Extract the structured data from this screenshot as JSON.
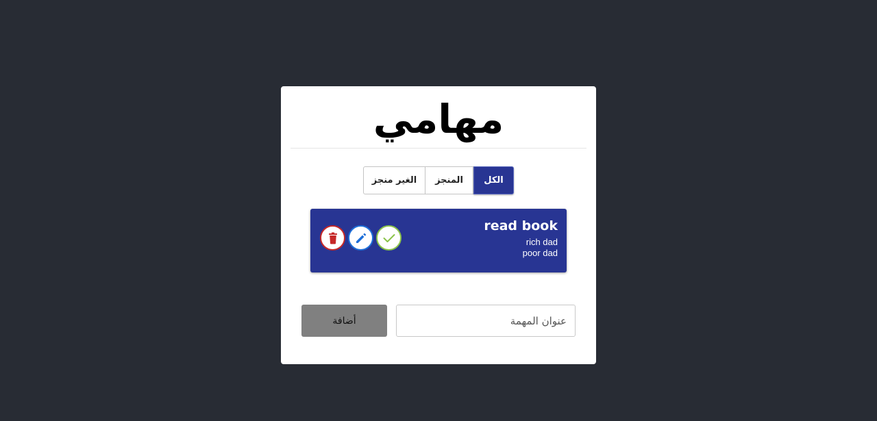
{
  "app": {
    "title": "مهامي"
  },
  "filters": {
    "all": "الكل",
    "done": "المنجز",
    "not_done": "الغير منجز",
    "active": "all"
  },
  "tasks": [
    {
      "title": "read book",
      "details": [
        "rich dad",
        "poor dad"
      ],
      "actions": {
        "complete_icon": "check-icon",
        "edit_icon": "pencil-icon",
        "delete_icon": "trash-icon"
      }
    }
  ],
  "form": {
    "title_placeholder": "عنوان المهمة",
    "title_value": "",
    "add_label": "أضافة"
  },
  "colors": {
    "background": "#282c34",
    "accent": "#283593",
    "delete": "#c62828",
    "edit": "#1e6fd9",
    "complete": "#8bc34a",
    "add_button": "#808080"
  }
}
